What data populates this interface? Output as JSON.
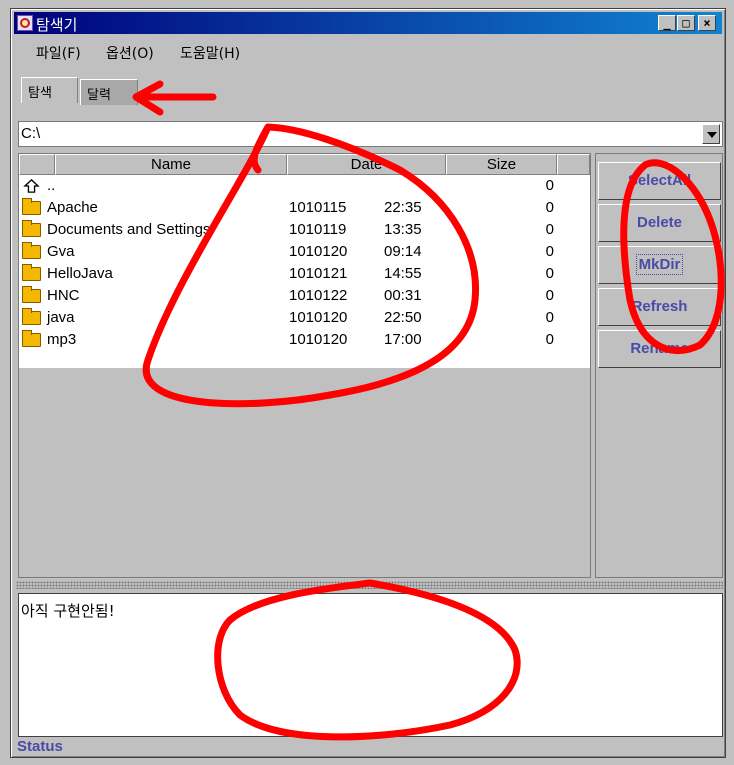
{
  "window": {
    "title": "탐색기",
    "controls": {
      "minimize": "_",
      "maximize": "□",
      "close": "×"
    }
  },
  "menu": [
    {
      "label": "파일(F)"
    },
    {
      "label": "옵션(O)"
    },
    {
      "label": "도움말(H)"
    }
  ],
  "tabs": [
    {
      "label": "탐색",
      "selected": true
    },
    {
      "label": "달력",
      "selected": false
    }
  ],
  "path": {
    "value": "C:\\"
  },
  "table": {
    "columns": [
      "Name",
      "Date",
      "Size"
    ],
    "rows": [
      {
        "icon": "up-directory-icon",
        "name": "..",
        "date": "",
        "time": "",
        "size": "0"
      },
      {
        "icon": "folder-icon",
        "name": "Apache",
        "date": "1010115",
        "time": "22:35",
        "size": "0"
      },
      {
        "icon": "folder-icon",
        "name": "Documents and Settings",
        "date": "1010119",
        "time": "13:35",
        "size": "0"
      },
      {
        "icon": "folder-icon",
        "name": "Gva",
        "date": "1010120",
        "time": "09:14",
        "size": "0"
      },
      {
        "icon": "folder-icon",
        "name": "HelloJava",
        "date": "1010121",
        "time": "14:55",
        "size": "0"
      },
      {
        "icon": "folder-icon",
        "name": "HNC",
        "date": "1010122",
        "time": "00:31",
        "size": "0"
      },
      {
        "icon": "folder-icon",
        "name": "java",
        "date": "1010120",
        "time": "22:50",
        "size": "0"
      },
      {
        "icon": "folder-icon",
        "name": "mp3",
        "date": "1010120",
        "time": "17:00",
        "size": "0"
      }
    ]
  },
  "actions": {
    "select_all": "SelectAll",
    "delete": "Delete",
    "mkdir": "MkDir",
    "refresh": "Refresh",
    "rename": "Rename"
  },
  "message": "아직 구현안됨!",
  "status": "Status",
  "colors": {
    "titlebar": "#00007b",
    "button_text": "#4a4aa8",
    "annotation": "#ff0000"
  }
}
